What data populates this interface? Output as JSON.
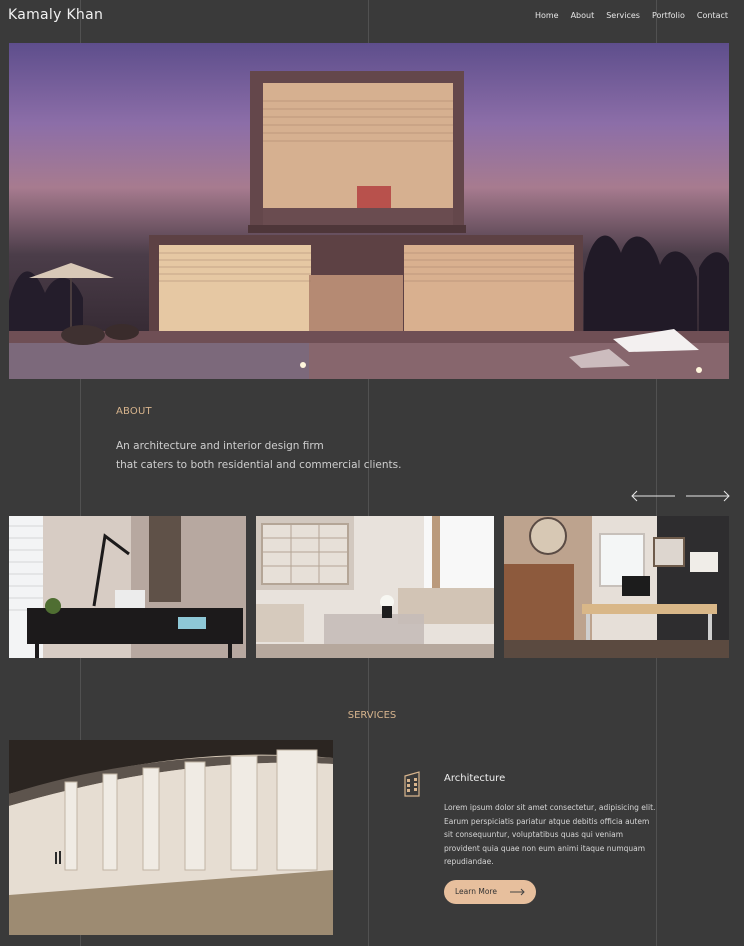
{
  "header": {
    "brand": "Kamaly Khan",
    "nav": [
      "Home",
      "About",
      "Services",
      "Portfolio",
      "Contact"
    ]
  },
  "about": {
    "title": "ABOUT",
    "text_line1": "An architecture and interior design firm",
    "text_line2": "that caters to both residential and commercial clients."
  },
  "services": {
    "title": "SERVICES",
    "item": {
      "name": "Architecture",
      "description": "Lorem ipsum dolor sit amet consectetur, adipisicing elit. Earum perspiciatis pariatur atque debitis officia autem sit consequuntur, voluptatibus quas qui veniam provident quia quae non eum animi itaque numquam repudiandae.",
      "button_label": "Learn More"
    }
  },
  "colors": {
    "background": "#3a3a3a",
    "accent": "#d7b48d",
    "button": "#e7bf9d"
  },
  "icons": {
    "prev": "arrow-left-icon",
    "next": "arrow-right-icon",
    "service": "building-icon",
    "button_arrow": "arrow-right-icon"
  }
}
